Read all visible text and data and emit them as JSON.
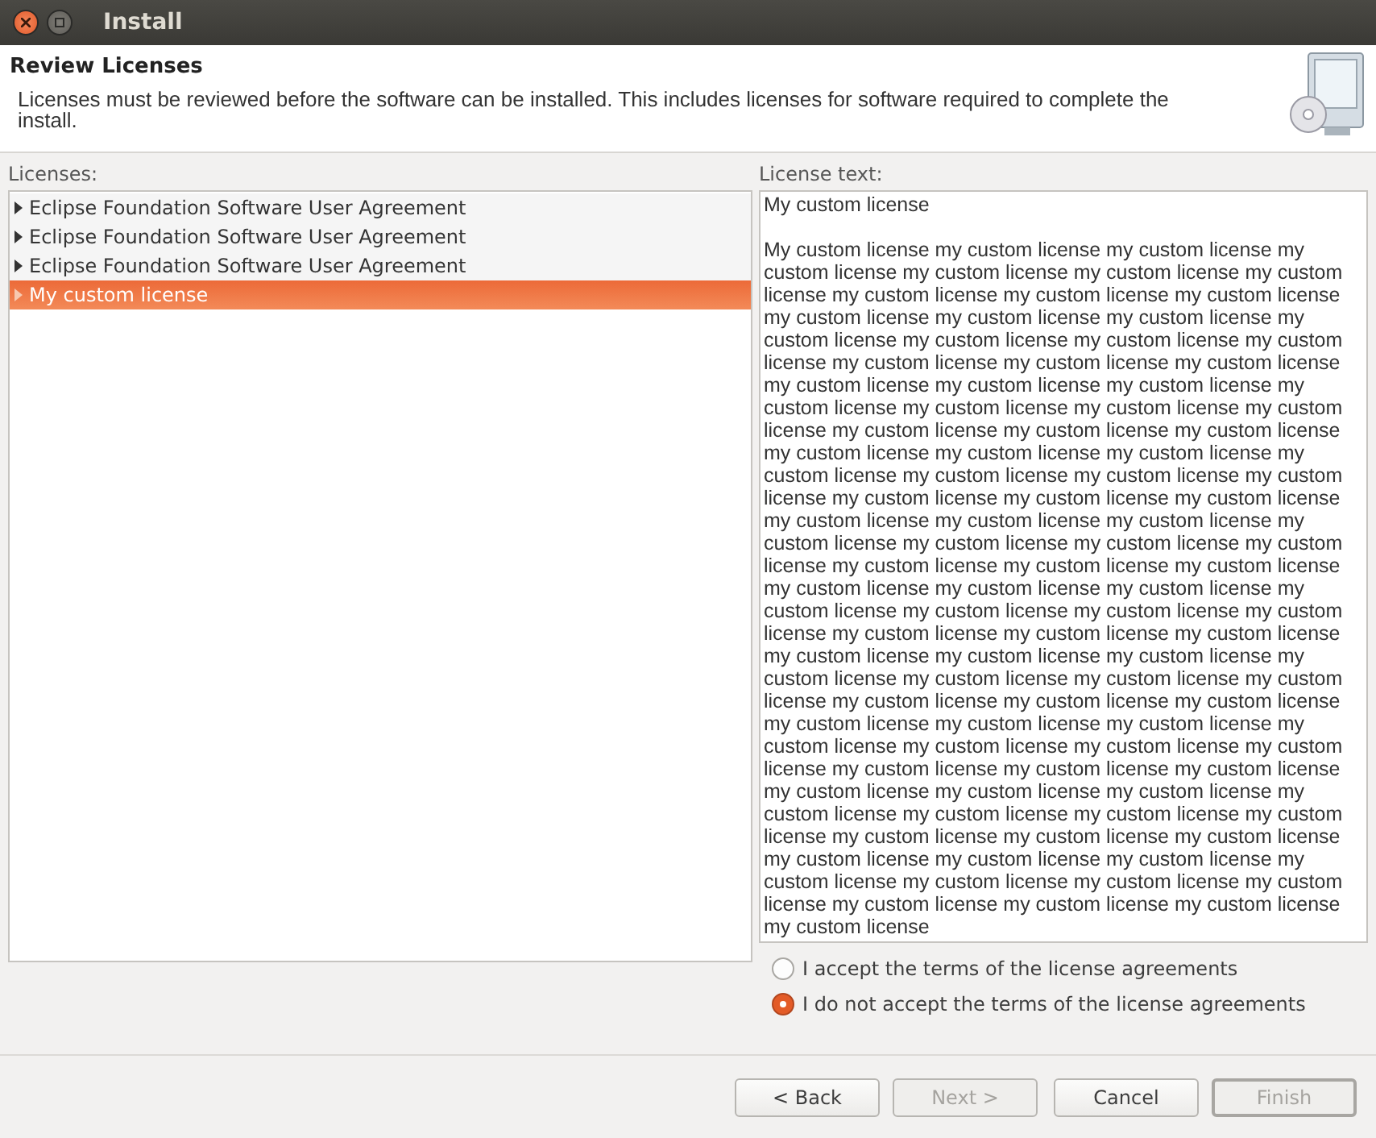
{
  "window": {
    "title": "Install"
  },
  "header": {
    "title": "Review Licenses",
    "description": "Licenses must be reviewed before the software can be installed.  This includes licenses for software required to complete the install."
  },
  "licenses": {
    "label": "Licenses:",
    "items": [
      {
        "label": "Eclipse Foundation Software User Agreement",
        "selected": false,
        "expanded": false
      },
      {
        "label": "Eclipse Foundation Software User Agreement",
        "selected": false,
        "expanded": false
      },
      {
        "label": "Eclipse Foundation Software User Agreement",
        "selected": false,
        "expanded": false
      },
      {
        "label": "My custom license",
        "selected": true,
        "expanded": false
      }
    ]
  },
  "license_text": {
    "label": "License text:",
    "heading": "My custom license",
    "body": "My custom license my custom license my custom license my custom license my custom license my custom license my custom license my custom license my custom license my custom license my custom license my custom license my custom license my custom license my custom license my custom license my custom license my custom license my custom license my custom license my custom license my custom license my custom license my custom license my custom license my custom license my custom license my custom license my custom license my custom license my custom license my custom license my custom license my custom license my custom license my custom license my custom license my custom license my custom license my custom license my custom license my custom license my custom license my custom license my custom license my custom license my custom license my custom license my custom license my custom license my custom license my custom license my custom license my custom license my custom license my custom license my custom license my custom license my custom license my custom license my custom license my custom license my custom license my custom license my custom license my custom license my custom license my custom license my custom license my custom license my custom license my custom license my custom license my custom license my custom license my custom license my custom license my custom license my custom license my custom license my custom license my custom license my custom license my custom license my custom license my custom license my custom license my custom license my custom license my custom license my custom license my custom license my custom license my custom license my custom license my custom license my custom license my custom license my custom license my custom license my custom license"
  },
  "options": [
    {
      "label": "I accept the terms of the license agreements",
      "selected": false
    },
    {
      "label": "I do not accept the terms of the license agreements",
      "selected": true
    }
  ],
  "buttons": [
    {
      "label": "< Back",
      "disabled": false,
      "default": false
    },
    {
      "label": "Next >",
      "disabled": true,
      "default": false
    },
    {
      "label": "Cancel",
      "disabled": false,
      "default": false
    },
    {
      "label": "Finish",
      "disabled": true,
      "default": true
    }
  ]
}
